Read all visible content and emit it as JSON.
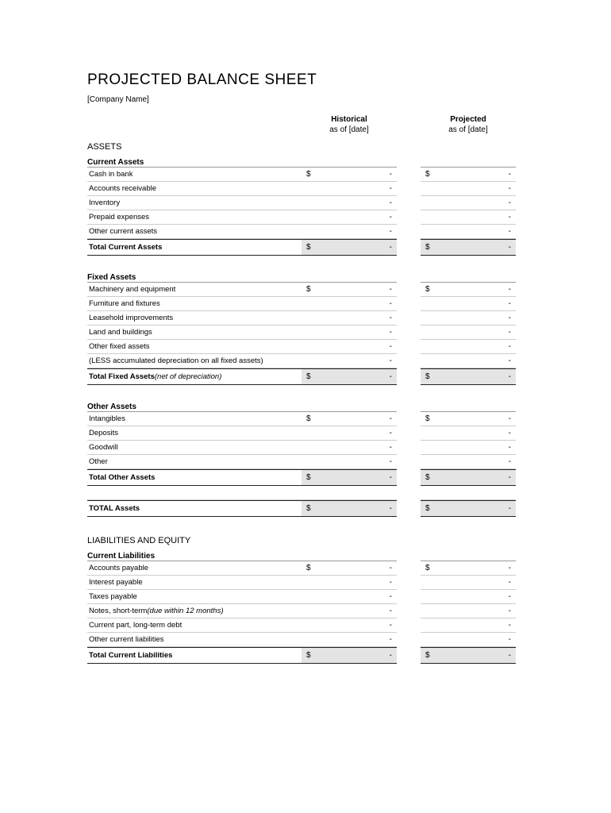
{
  "title": "PROJECTED BALANCE SHEET",
  "company": "[Company Name]",
  "columns": {
    "historical": {
      "title": "Historical",
      "subtitle": "as of [date]"
    },
    "projected": {
      "title": "Projected",
      "subtitle": "as of [date]"
    }
  },
  "sections": {
    "assets": {
      "title": "ASSETS",
      "current": {
        "title": "Current Assets",
        "rows": [
          {
            "label": "Cash in bank",
            "hist_cur": "$",
            "hist_val": "-",
            "proj_cur": "$",
            "proj_val": "-"
          },
          {
            "label": "Accounts receivable",
            "hist_cur": "",
            "hist_val": "-",
            "proj_cur": "",
            "proj_val": "-"
          },
          {
            "label": "Inventory",
            "hist_cur": "",
            "hist_val": "-",
            "proj_cur": "",
            "proj_val": "-"
          },
          {
            "label": "Prepaid expenses",
            "hist_cur": "",
            "hist_val": "-",
            "proj_cur": "",
            "proj_val": "-"
          },
          {
            "label": "Other current assets",
            "hist_cur": "",
            "hist_val": "-",
            "proj_cur": "",
            "proj_val": "-"
          }
        ],
        "total": {
          "label": "Total Current Assets",
          "hist_cur": "$",
          "hist_val": "-",
          "proj_cur": "$",
          "proj_val": "-"
        }
      },
      "fixed": {
        "title": "Fixed Assets",
        "rows": [
          {
            "label": "Machinery and equipment",
            "hist_cur": "$",
            "hist_val": "-",
            "proj_cur": "$",
            "proj_val": "-"
          },
          {
            "label": "Furniture and fixtures",
            "hist_cur": "",
            "hist_val": "-",
            "proj_cur": "",
            "proj_val": "-"
          },
          {
            "label": "Leasehold improvements",
            "hist_cur": "",
            "hist_val": "-",
            "proj_cur": "",
            "proj_val": "-"
          },
          {
            "label": "Land and buildings",
            "hist_cur": "",
            "hist_val": "-",
            "proj_cur": "",
            "proj_val": "-"
          },
          {
            "label": "Other fixed assets",
            "hist_cur": "",
            "hist_val": "-",
            "proj_cur": "",
            "proj_val": "-"
          },
          {
            "label": "(LESS accumulated depreciation on all fixed assets)",
            "hist_cur": "",
            "hist_val": "-",
            "proj_cur": "",
            "proj_val": "-"
          }
        ],
        "total": {
          "label": "Total Fixed Assets",
          "note": "(net of depreciation)",
          "hist_cur": "$",
          "hist_val": "-",
          "proj_cur": "$",
          "proj_val": "-"
        }
      },
      "other": {
        "title": "Other Assets",
        "rows": [
          {
            "label": "Intangibles",
            "hist_cur": "$",
            "hist_val": "-",
            "proj_cur": "$",
            "proj_val": "-"
          },
          {
            "label": "Deposits",
            "hist_cur": "",
            "hist_val": "-",
            "proj_cur": "",
            "proj_val": "-"
          },
          {
            "label": "Goodwill",
            "hist_cur": "",
            "hist_val": "-",
            "proj_cur": "",
            "proj_val": "-"
          },
          {
            "label": "Other",
            "hist_cur": "",
            "hist_val": "-",
            "proj_cur": "",
            "proj_val": "-"
          }
        ],
        "total": {
          "label": "Total Other Assets",
          "hist_cur": "$",
          "hist_val": "-",
          "proj_cur": "$",
          "proj_val": "-"
        }
      },
      "grand_total": {
        "label": "TOTAL Assets",
        "hist_cur": "$",
        "hist_val": "-",
        "proj_cur": "$",
        "proj_val": "-"
      }
    },
    "liabilities": {
      "title": "LIABILITIES AND EQUITY",
      "current": {
        "title": "Current Liabilities",
        "rows": [
          {
            "label": "Accounts payable",
            "hist_cur": "$",
            "hist_val": "-",
            "proj_cur": "$",
            "proj_val": "-"
          },
          {
            "label": "Interest payable",
            "hist_cur": "",
            "hist_val": "-",
            "proj_cur": "",
            "proj_val": "-"
          },
          {
            "label": "Taxes payable",
            "hist_cur": "",
            "hist_val": "-",
            "proj_cur": "",
            "proj_val": "-"
          },
          {
            "label": "Notes, short-term",
            "note": "(due within 12 months)",
            "hist_cur": "",
            "hist_val": "-",
            "proj_cur": "",
            "proj_val": "-"
          },
          {
            "label": "Current part, long-term debt",
            "hist_cur": "",
            "hist_val": "-",
            "proj_cur": "",
            "proj_val": "-"
          },
          {
            "label": "Other current liabilities",
            "hist_cur": "",
            "hist_val": "-",
            "proj_cur": "",
            "proj_val": "-"
          }
        ],
        "total": {
          "label": "Total Current Liabilities",
          "hist_cur": "$",
          "hist_val": "-",
          "proj_cur": "$",
          "proj_val": "-"
        }
      }
    }
  }
}
